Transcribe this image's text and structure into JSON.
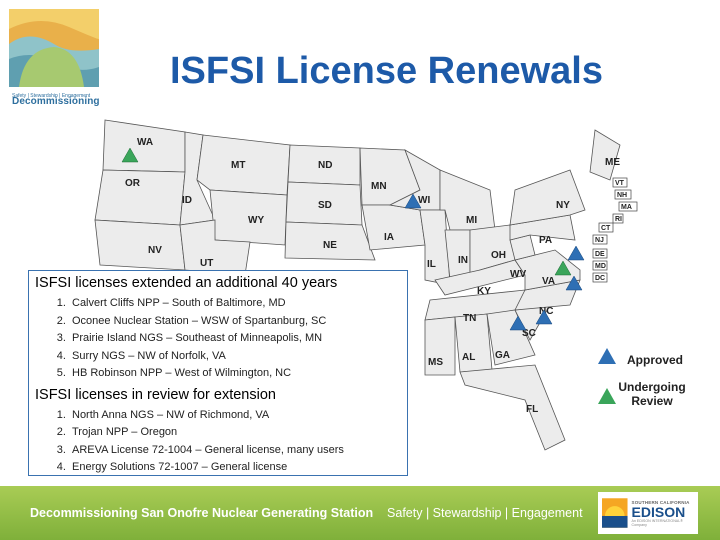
{
  "header": {
    "title": "ISFSI License Renewals",
    "logo_text": "Decommissioning",
    "logo_tagline": "Safety | Stewardship | Engagement"
  },
  "map": {
    "states": [
      "WA",
      "MT",
      "ND",
      "MN",
      "OR",
      "ID",
      "SD",
      "WI",
      "WY",
      "IA",
      "NE",
      "NV",
      "UT",
      "IL",
      "IN",
      "OH",
      "MI",
      "PA",
      "NY",
      "ME",
      "WV",
      "VA",
      "KY",
      "TN",
      "NC",
      "SC",
      "GA",
      "AL",
      "MS",
      "FL"
    ],
    "small_states": [
      "VT",
      "NH",
      "MA",
      "RI",
      "CT",
      "NJ",
      "DE",
      "MD",
      "DC"
    ],
    "markers": [
      {
        "site": "Undergoing Review - WA",
        "status": "review"
      },
      {
        "site": "Approved - WI",
        "status": "approved"
      },
      {
        "site": "Undergoing Review - VA",
        "status": "review"
      },
      {
        "site": "Approved - VA",
        "status": "approved"
      },
      {
        "site": "Approved - MD",
        "status": "approved"
      },
      {
        "site": "Approved - NC",
        "status": "approved"
      },
      {
        "site": "Approved - SC",
        "status": "approved"
      }
    ]
  },
  "legend": {
    "approved": "Approved",
    "review": "Undergoing Review",
    "approved_color": "#2e6fb4",
    "review_color": "#3aa55a"
  },
  "infobox": {
    "extended_heading": "ISFSI licenses extended an additional 40 years",
    "extended": [
      "Calvert Cliffs NPP – South of Baltimore, MD",
      "Oconee Nuclear Station – WSW of Spartanburg, SC",
      "Prairie Island NGS – Southeast of Minneapolis, MN",
      "Surry NGS – NW of Norfolk, VA",
      "HB Robinson NPP – West of Wilmington, NC"
    ],
    "review_heading": "ISFSI licenses in review for extension",
    "review": [
      "North Anna NGS – NW of Richmond, VA",
      "Trojan NPP – Oregon",
      "AREVA License 72-1004 – General license, many users",
      "Energy Solutions 72-1007 – General license"
    ]
  },
  "footer": {
    "station": "Decommissioning San Onofre Nuclear Generating Station",
    "values": "Safety | Stewardship | Engagement",
    "edison_sub": "SOUTHERN CALIFORNIA",
    "edison_main": "EDISON",
    "edison_tag": "An EDISON INTERNATIONAL® Company"
  }
}
